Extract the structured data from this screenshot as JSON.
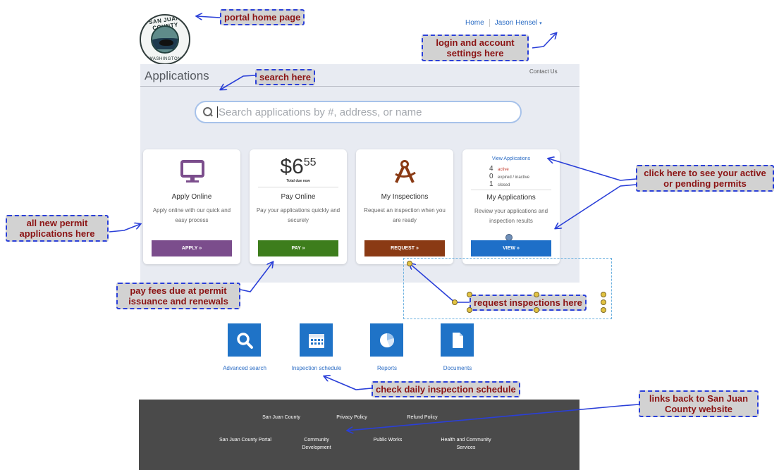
{
  "header": {
    "logo": {
      "top_text": "SAN JUAN COUNTY",
      "bottom_text": "WASHINGTON"
    },
    "nav": {
      "home": "Home",
      "user": "Jason Hensel"
    },
    "dropdown_icon": "caret-down-icon",
    "contact": "Contact Us"
  },
  "main": {
    "title": "Applications",
    "search": {
      "placeholder": "Search applications by #, address, or name",
      "icon": "search-icon"
    }
  },
  "cards": {
    "apply": {
      "icon": "monitor-icon",
      "title": "Apply Online",
      "desc": "Apply online with our quick and easy process",
      "button": "APPLY »",
      "color": "#7b4d8c"
    },
    "pay": {
      "dollars": "$6",
      "cents": "55",
      "total_label": "Total due now",
      "title": "Pay Online",
      "desc": "Pay your applications quickly and securely",
      "button": "PAY »",
      "color": "#3d7d1c"
    },
    "inspections": {
      "icon": "compass-icon",
      "title": "My Inspections",
      "desc": "Request an inspection when you are ready",
      "button": "REQUEST »",
      "color": "#8a3a14"
    },
    "applications": {
      "link": "View Applications",
      "stats": [
        {
          "count": "4",
          "label": "active"
        },
        {
          "count": "0",
          "label": "expired / inactive"
        },
        {
          "count": "1",
          "label": "closed"
        }
      ],
      "title": "My Applications",
      "desc": "Review your applications and inspection results",
      "button": "VIEW »",
      "color": "#1e6fc8"
    }
  },
  "shortcuts": [
    {
      "icon": "search-icon",
      "label": "Advanced search"
    },
    {
      "icon": "calendar-icon",
      "label": "Inspection schedule"
    },
    {
      "icon": "pie-chart-icon",
      "label": "Reports"
    },
    {
      "icon": "document-icon",
      "label": "Documents"
    }
  ],
  "footer": {
    "row1": [
      "San Juan County",
      "Privacy Policy",
      "Refund Policy"
    ],
    "row2": [
      "San Juan County Portal",
      "Community Development",
      "Public Works",
      "Health and Community Services"
    ]
  },
  "callouts": {
    "home": "portal home page",
    "login": "login and account settings here",
    "search": "search here",
    "apps": "click here to see your active or pending permits",
    "new": "all new permit applications here",
    "fees": "pay fees due at permit issuance and renewals",
    "inspect": "request inspections here",
    "schedule": "check daily inspection schedule",
    "links": "links back to San Juan County website"
  }
}
